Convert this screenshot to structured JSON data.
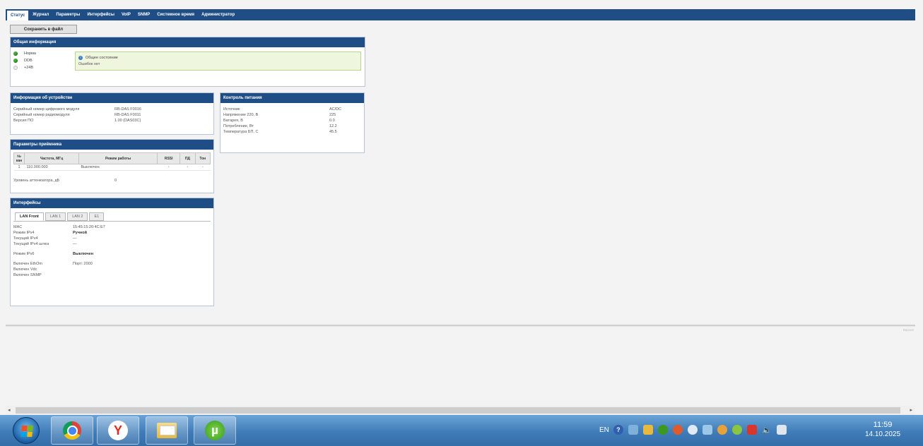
{
  "nav": {
    "tabs": [
      {
        "label": "Статус",
        "active": true
      },
      {
        "label": "Журнал"
      },
      {
        "label": "Параметры"
      },
      {
        "label": "Интерфейсы"
      },
      {
        "label": "VoIP"
      },
      {
        "label": "SNMP"
      },
      {
        "label": "Системное время"
      },
      {
        "label": "Администратор"
      }
    ]
  },
  "toolbar": {
    "save_label": "Сохранить в файл"
  },
  "general": {
    "title": "Общая информация",
    "items": [
      {
        "label": "Норма",
        "status": "green"
      },
      {
        "label": "DDB",
        "status": "green"
      },
      {
        "label": "+24В",
        "status": "gray"
      }
    ],
    "state_title": "Общее состояние",
    "state_text": "Ошибок нет"
  },
  "device": {
    "title": "Информация об устройстве",
    "rows": [
      {
        "k": "Серийный номер цифрового модуля",
        "v": "RB-DAS F0016"
      },
      {
        "k": "Серийный номер радиомодуля",
        "v": "RB-DAS F0011"
      },
      {
        "k": "Версия ПО",
        "v": "1.00 (DAS03C)"
      }
    ]
  },
  "power": {
    "title": "Контроль питания",
    "rows": [
      {
        "k": "Источник",
        "v": "AC/DC"
      },
      {
        "k": "Напряжение 220, В",
        "v": "225"
      },
      {
        "k": "Батарея, В",
        "v": "0.0"
      },
      {
        "k": "Потребление, Вт",
        "v": "12.2"
      },
      {
        "k": "Температура БП, С",
        "v": "45.5"
      }
    ]
  },
  "receiver": {
    "title": "Параметры приёмника",
    "headers": {
      "num": "№ кан",
      "freq": "Частота, МГц",
      "mode": "Режим работы",
      "rssi": "RSSI",
      "pd": "ПД",
      "ton": "Тон"
    },
    "rows": [
      {
        "num": "1",
        "freq": "110.000.000",
        "mode": "Выключен",
        "rssi": "-",
        "pd": "-",
        "ton": "-"
      }
    ],
    "atten_label": "Уровень аттенюатора, дБ",
    "atten_value": "0"
  },
  "interfaces": {
    "title": "Интерфейсы",
    "tabs": [
      {
        "label": "LAN Front",
        "active": true
      },
      {
        "label": "LAN 1"
      },
      {
        "label": "LAN 2"
      },
      {
        "label": "E1"
      }
    ],
    "rows": [
      {
        "k": "MAC",
        "v": "15:45:15:20:4C:E7",
        "bold": false
      },
      {
        "k": "Режим IPv4",
        "v": "Ручной",
        "bold": true
      },
      {
        "k": "Текущий IPv4",
        "v": "—",
        "bold": false
      },
      {
        "k": "Текущий IPv4 шлюз",
        "v": "—",
        "bold": false
      },
      {
        "k": "Режим IPv6",
        "v": "Выключен",
        "bold": true
      },
      {
        "k": "Включен EthOm",
        "v": "Порт: 2000",
        "bold": false
      },
      {
        "k": "Включен Vdc",
        "v": "",
        "bold": false
      },
      {
        "k": "Включен SNMP",
        "v": "",
        "bold": false
      }
    ]
  },
  "footer": {
    "corner_text": "Версия"
  },
  "taskbar": {
    "apps": [
      "chrome-icon",
      "yandex-icon",
      "folder-icon",
      "utorrent-icon"
    ],
    "yandex_glyph": "Y",
    "utorrent_glyph": "µ",
    "lang": "EN",
    "time": "11:59",
    "date": "14.10.2025"
  },
  "colors": {
    "header": "#1f4e87",
    "status_ok": "#46a63a",
    "state_bg": "#eef6de"
  }
}
